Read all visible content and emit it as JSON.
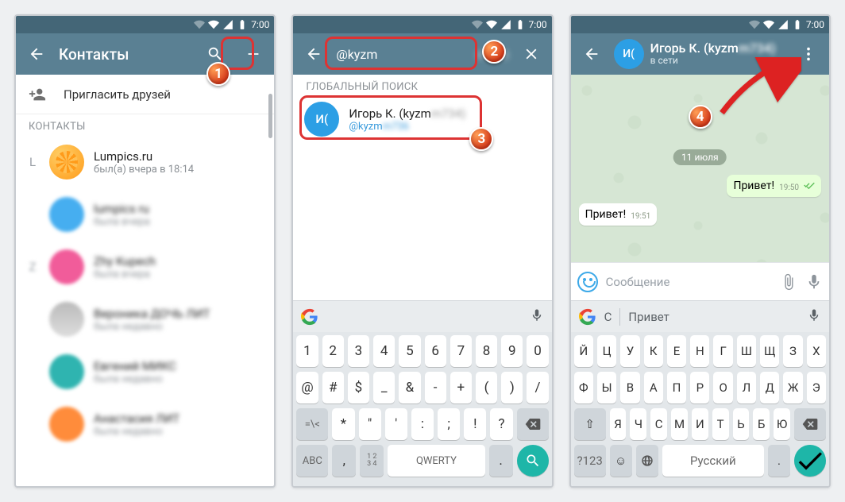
{
  "status": {
    "time": "7:00"
  },
  "screen1": {
    "title": "Контакты",
    "invite": "Пригласить друзей",
    "section": "КОНТАКТЫ",
    "contacts": [
      {
        "letter": "L",
        "name": "Lumpics.ru",
        "sub": "был(а) вчера в 18:14"
      }
    ]
  },
  "screen2": {
    "query": "@kyzm",
    "section": "ГЛОБАЛЬНЫЙ ПОИСК",
    "result": {
      "avatar": "И(",
      "name": "Игорь К. (kyzm",
      "username": "@kyzm"
    },
    "keyboard": {
      "rows": [
        [
          "1",
          "2",
          "3",
          "4",
          "5",
          "6",
          "7",
          "8",
          "9",
          "0"
        ],
        [
          "@",
          "#",
          "$",
          "_",
          "&",
          "-",
          "+",
          "(",
          ")",
          "/"
        ],
        [
          "*",
          "\"",
          "'",
          ":",
          ";",
          "!",
          "?"
        ]
      ],
      "shift": "=\\<",
      "back": "⌫",
      "mode": "ABC",
      "space": "QWERTY",
      "alt": "1234",
      "comma": ",",
      "dot": "."
    }
  },
  "screen3": {
    "contact": {
      "avatar": "И(",
      "name": "Игорь К. (kyzm",
      "status": "в сети"
    },
    "date": "11 июля",
    "msg_out": {
      "text": "Привет!",
      "time": "19:50"
    },
    "msg_in": {
      "text": "Привет!",
      "time": "19:51"
    },
    "placeholder": "Сообщение",
    "suggest": {
      "a": "С",
      "b": "Привет"
    },
    "keyboard": {
      "rows": [
        [
          "Й",
          "Ц",
          "У",
          "К",
          "Е",
          "Н",
          "Г",
          "Ш",
          "Щ",
          "З",
          "Х"
        ],
        [
          "Ф",
          "Ы",
          "В",
          "А",
          "П",
          "Р",
          "О",
          "Л",
          "Д",
          "Ж",
          "Э"
        ],
        [
          "Я",
          "Ч",
          "С",
          "М",
          "И",
          "Т",
          "Ь",
          "Б",
          "Ю"
        ]
      ],
      "shift": "⇧",
      "back": "⌫",
      "mode": "?123",
      "space": "Русский",
      "comma": ",",
      "dot": "."
    }
  },
  "badges": {
    "b1": "1",
    "b2": "2",
    "b3": "3",
    "b4": "4"
  }
}
